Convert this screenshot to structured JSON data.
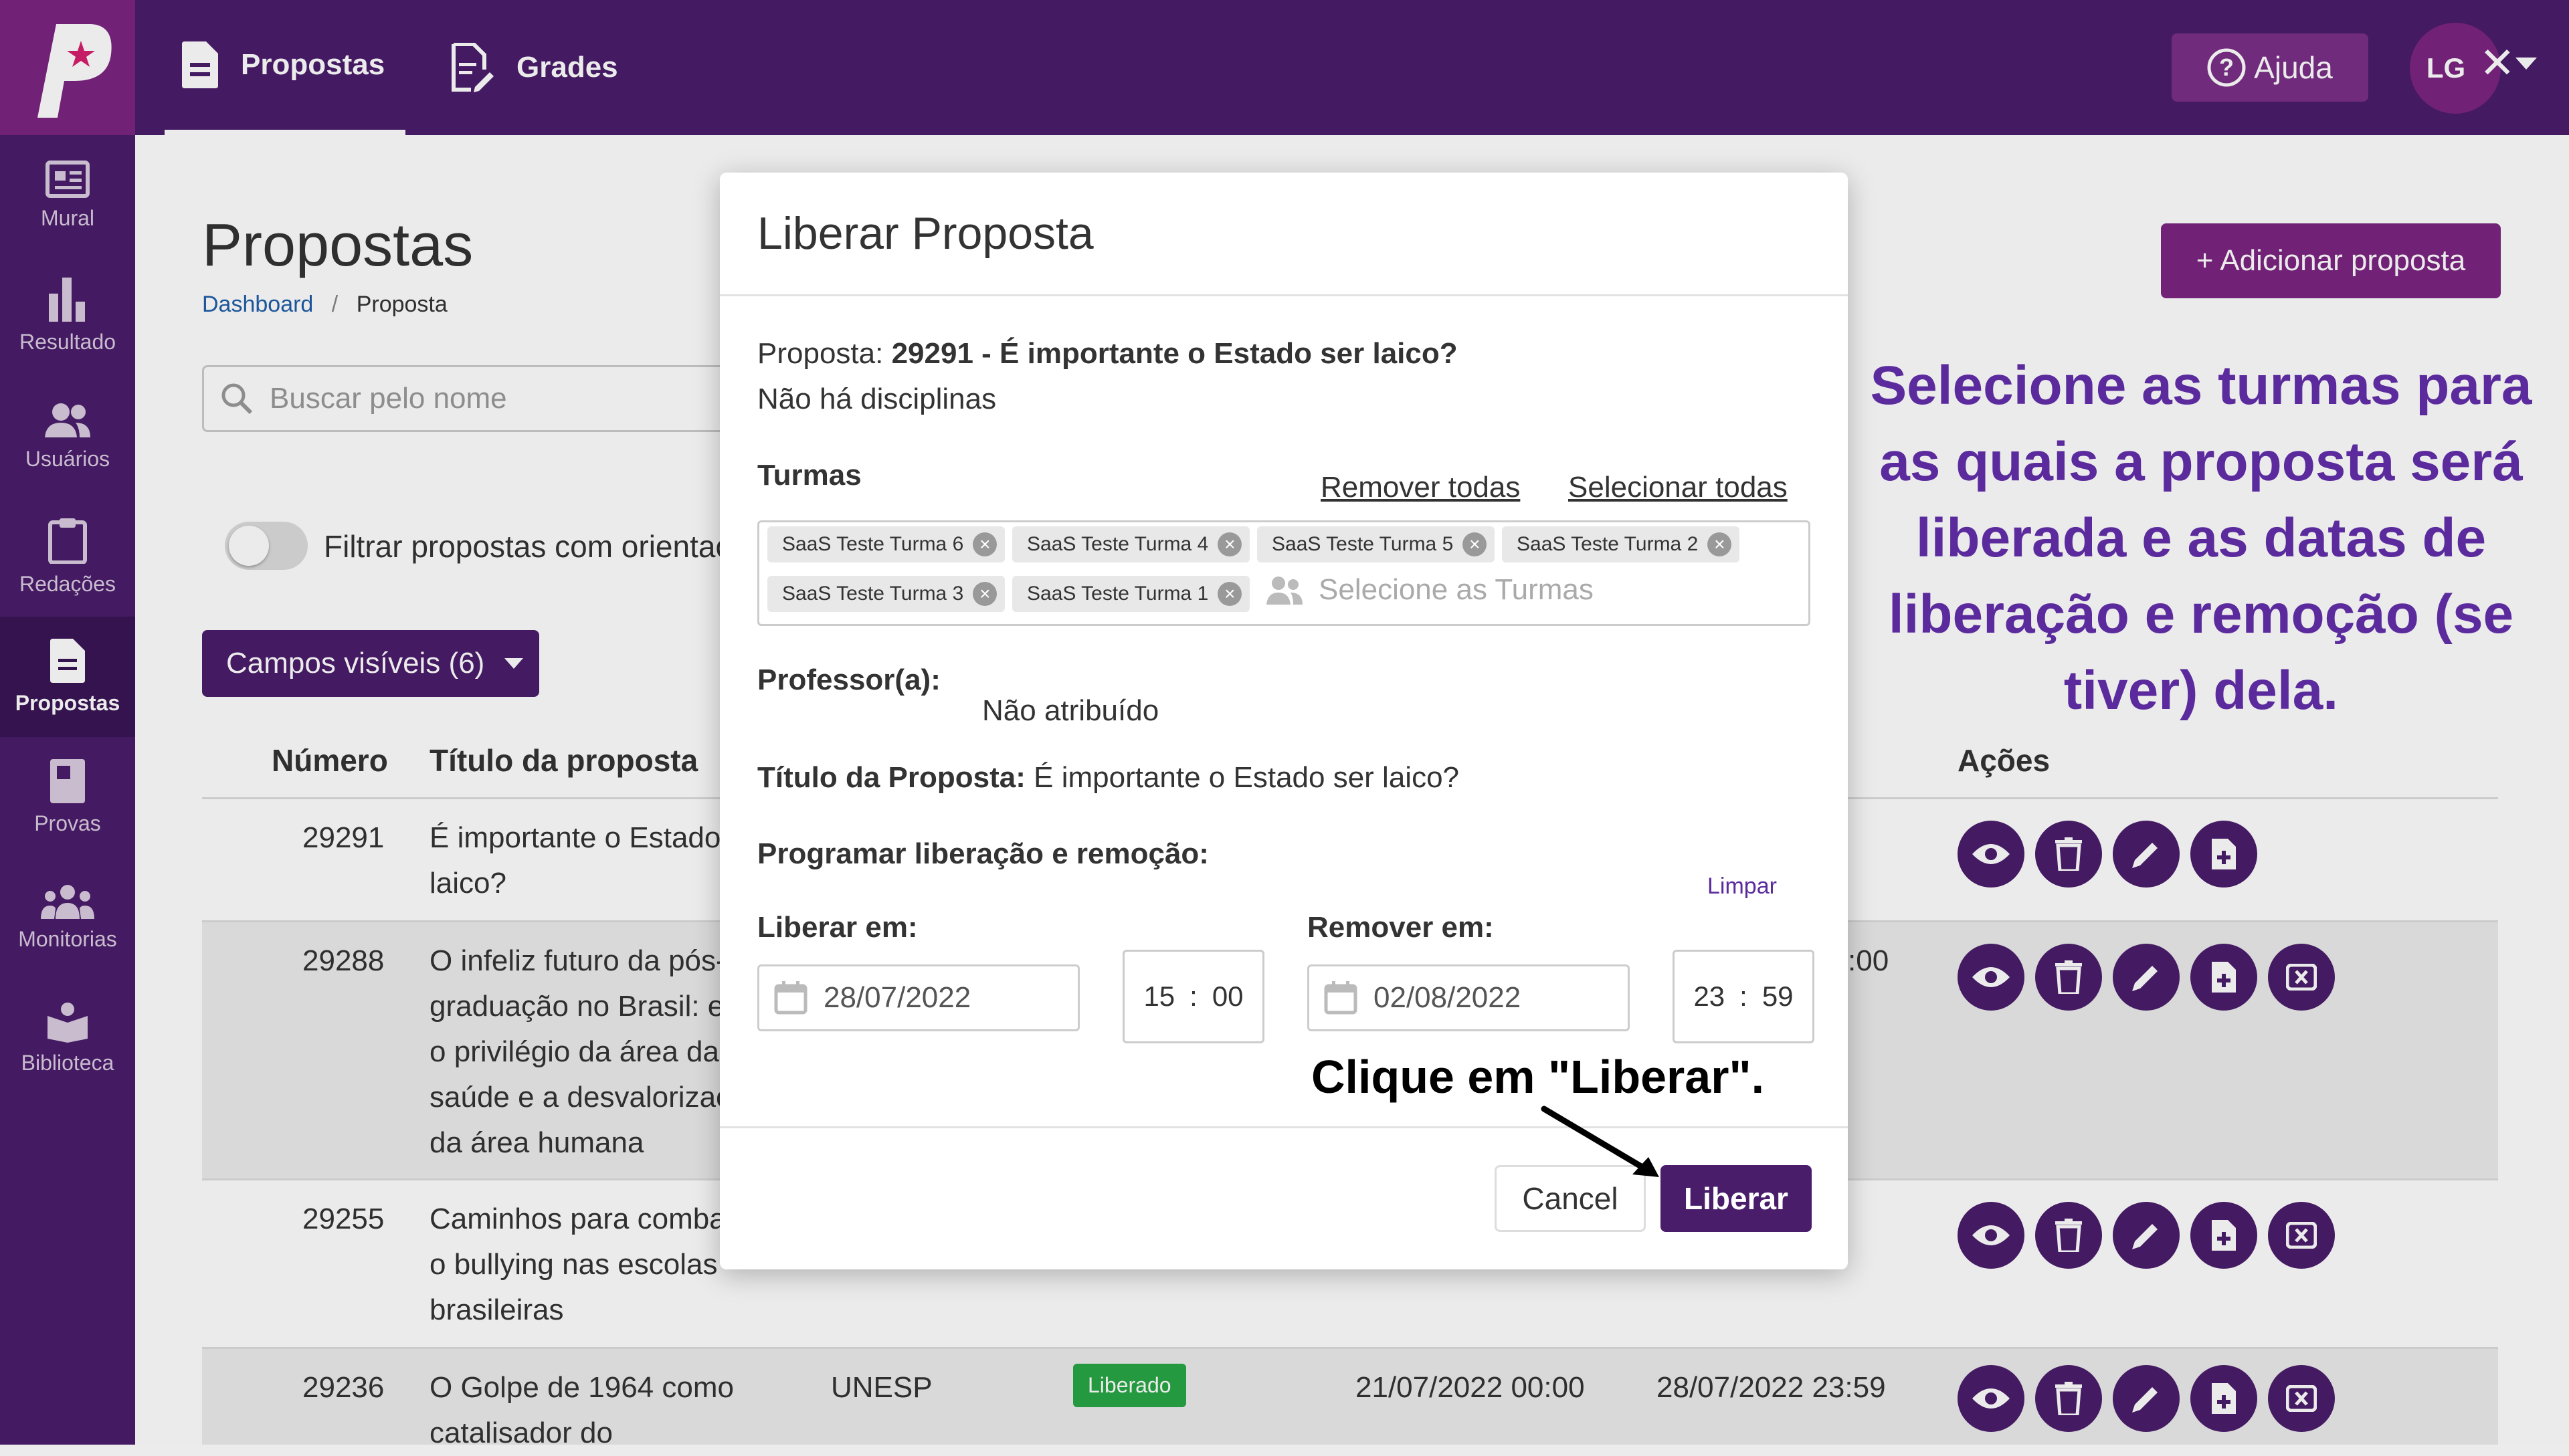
{
  "topbar": {
    "tabs": [
      {
        "label": "Propostas",
        "icon": "document-icon"
      },
      {
        "label": "Grades",
        "icon": "edit-document-icon"
      }
    ],
    "help_label": "Ajuda",
    "avatar_initials": "LG"
  },
  "sidebar": {
    "items": [
      {
        "label": "Mural",
        "icon": "board-icon"
      },
      {
        "label": "Resultado",
        "icon": "bar-chart-icon"
      },
      {
        "label": "Usuários",
        "icon": "users-icon"
      },
      {
        "label": "Redações",
        "icon": "clipboard-icon"
      },
      {
        "label": "Propostas",
        "icon": "document-icon"
      },
      {
        "label": "Provas",
        "icon": "book-icon"
      },
      {
        "label": "Monitorias",
        "icon": "group-icon"
      },
      {
        "label": "Biblioteca",
        "icon": "library-icon"
      }
    ]
  },
  "page": {
    "title": "Propostas",
    "breadcrumb_home": "Dashboard",
    "breadcrumb_sep": "/",
    "breadcrumb_current": "Proposta",
    "search_placeholder": "Buscar pelo nome",
    "toggle_label": "Filtrar propostas com orientação",
    "fields_button": "Campos visíveis (6)",
    "add_button": "+ Adicionar proposta"
  },
  "table": {
    "headers": {
      "number": "Número",
      "title": "Título da proposta",
      "actions": "Ações"
    },
    "rows": [
      {
        "number": "29291",
        "title_lines": [
          "É importante o Estado ser",
          "laico?"
        ]
      },
      {
        "number": "29288",
        "title_lines": [
          "O infeliz futuro da pós-",
          "graduação no Brasil: e",
          "o privilégio da área da",
          "saúde e a desvalorização",
          "da área humana"
        ],
        "release_partial": ":00"
      },
      {
        "number": "29255",
        "title_lines": [
          "Caminhos para combater",
          "o bullying nas escolas",
          "brasileiras"
        ]
      },
      {
        "number": "29236",
        "title_lines": [
          "O Golpe de 1964 como",
          "catalisador do"
        ],
        "institution": "UNESP",
        "status": "Liberado",
        "release": "21/07/2022 00:00",
        "removal": "28/07/2022 23:59"
      }
    ]
  },
  "modal": {
    "title": "Liberar Proposta",
    "proposal_label": "Proposta:",
    "proposal_value": "29291 - É importante o Estado ser laico?",
    "no_disciplines": "Não há disciplinas",
    "classes_label": "Turmas",
    "remove_all": "Remover todas",
    "select_all": "Selecionar todas",
    "tags": [
      "SaaS Teste Turma 6",
      "SaaS Teste Turma 4",
      "SaaS Teste Turma 5",
      "SaaS Teste Turma 2",
      "SaaS Teste Turma 3",
      "SaaS Teste Turma 1"
    ],
    "classes_placeholder": "Selecione as Turmas",
    "teacher_label": "Professor(a):",
    "teacher_value": "Não atribuído",
    "title_label": "Título da Proposta:",
    "title_value": "É importante o Estado ser laico?",
    "schedule_label": "Programar liberação e remoção:",
    "clear_label": "Limpar",
    "release_label": "Liberar em:",
    "release_date": "28/07/2022",
    "release_hour": "15",
    "release_min": "00",
    "remove_label": "Remover em:",
    "remove_date": "02/08/2022",
    "remove_hour": "23",
    "remove_min": "59",
    "time_sep": ":",
    "cancel_label": "Cancel",
    "submit_label": "Liberar"
  },
  "annotations": {
    "instruction": "Selecione as turmas para as quais a proposta será liberada e as datas de liberação e remoção (se tiver) dela.",
    "click_hint": "Clique em \"Liberar\"."
  },
  "colors": {
    "primary": "#4a1d6b",
    "accent": "#7b2480",
    "annotation": "#5b2b9e",
    "success": "#28a745"
  }
}
